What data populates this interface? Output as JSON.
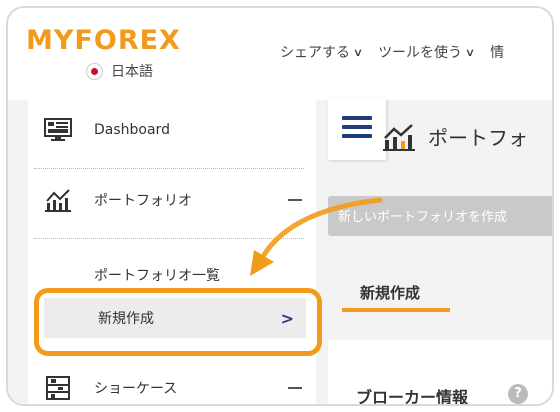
{
  "header": {
    "logo_text": "MYFOREX",
    "language": "日本語",
    "nav": [
      {
        "label": "シェアする"
      },
      {
        "label": "ツールを使う"
      },
      {
        "label": "情"
      }
    ]
  },
  "sidebar": {
    "dashboard": "Dashboard",
    "portfolio": "ポートフォリオ",
    "portfolio_list": "ポートフォリオ一覧",
    "new_create": "新規作成",
    "showcase": "ショーケース"
  },
  "main": {
    "title": "ポートフォ",
    "notice": "新しいポートフォリオを作成",
    "tab": "新規作成",
    "section_title": "ブローカー情報",
    "help_mark": "?"
  },
  "colors": {
    "accent": "#f29b1a",
    "navy": "#1f3d7a"
  }
}
